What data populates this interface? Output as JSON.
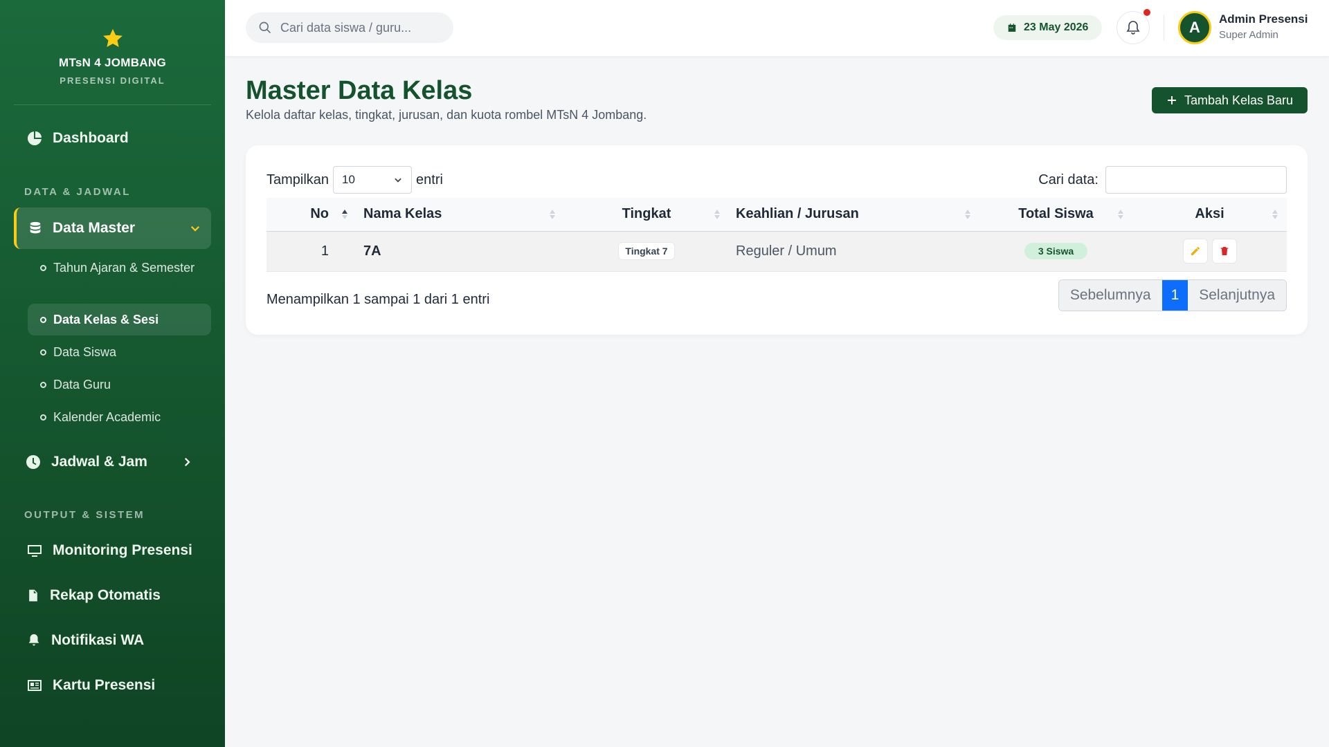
{
  "brand": {
    "name": "MTsN 4 JOMBANG",
    "subtitle": "PRESENSI DIGITAL"
  },
  "sidebar": {
    "dashboard": "Dashboard",
    "section_data": "DATA & JADWAL",
    "data_master": "Data Master",
    "sub_items": [
      "Tahun Ajaran & Semester",
      "Data Kelas & Sesi",
      "Data Siswa",
      "Data Guru",
      "Kalender Academic"
    ],
    "jadwal": "Jadwal & Jam",
    "section_output": "OUTPUT & SISTEM",
    "monitoring": "Monitoring Presensi",
    "rekap": "Rekap Otomatis",
    "notifikasi": "Notifikasi WA",
    "kartu": "Kartu Presensi"
  },
  "topbar": {
    "search_placeholder": "Cari data siswa / guru...",
    "date": "23 May 2026",
    "avatar_initial": "A",
    "user_name": "Admin Presensi",
    "user_role": "Super Admin"
  },
  "page": {
    "title": "Master Data Kelas",
    "subtitle": "Kelola daftar kelas, tingkat, jurusan, dan kuota rombel MTsN 4 Jombang.",
    "add_button": "Tambah Kelas Baru"
  },
  "table_controls": {
    "show_label": "Tampilkan",
    "show_value": "10",
    "entries_label": "entri",
    "search_label": "Cari data:"
  },
  "table": {
    "columns": [
      "No",
      "Nama Kelas",
      "Tingkat",
      "Keahlian / Jurusan",
      "Total Siswa",
      "Aksi"
    ],
    "rows": [
      {
        "no": "1",
        "nama": "7A",
        "tingkat": "Tingkat 7",
        "keahlian": "Reguler / Umum",
        "total": "3 Siswa"
      }
    ]
  },
  "footer": {
    "info": "Menampilkan 1 sampai 1 dari 1 entri",
    "prev": "Sebelumnya",
    "page": "1",
    "next": "Selanjutnya"
  },
  "colors": {
    "primary": "#14532d",
    "accent": "#facc15",
    "page_active": "#0d6efd",
    "danger": "#dc2626",
    "edit": "#eab308"
  }
}
